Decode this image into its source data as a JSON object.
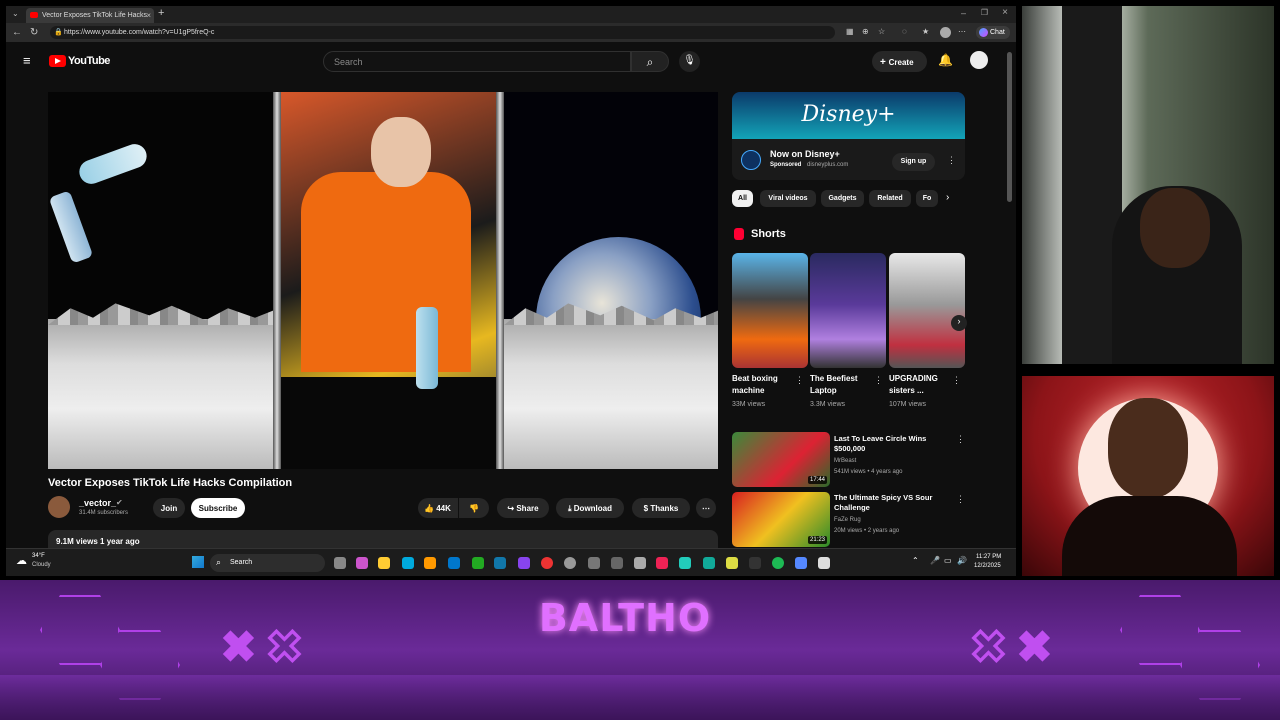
{
  "browser": {
    "tab_title": "Vector Exposes TikTok Life Hacks",
    "url": "https://www.youtube.com/watch?v=U1gP5freQ-c",
    "chat_label": "Chat"
  },
  "youtube": {
    "logo_text": "YouTube",
    "search_placeholder": "Search",
    "create_label": "Create"
  },
  "video": {
    "title": "Vector Exposes TikTok Life Hacks Compilation",
    "channel": "_vector_",
    "subscribers": "31.4M subscribers",
    "join_label": "Join",
    "subscribe_label": "Subscribe",
    "likes": "44K",
    "share_label": "Share",
    "download_label": "Download",
    "thanks_label": "Thanks",
    "views_date": "9.1M views  1 year ago"
  },
  "ad": {
    "brand_logo": "Disney+",
    "title": "Now on Disney+",
    "sponsored": "Sponsored",
    "domain": "disneyplus.com",
    "cta": "Sign up"
  },
  "chips": [
    "All",
    "Viral videos",
    "Gadgets",
    "Related",
    "Fo"
  ],
  "shorts": {
    "heading": "Shorts",
    "items": [
      {
        "title": "Beat boxing machine",
        "views": "33M views"
      },
      {
        "title": "The Beefiest Laptop",
        "views": "3.3M views"
      },
      {
        "title": "UPGRADING sisters ...",
        "views": "107M views"
      }
    ]
  },
  "related": [
    {
      "title": "Last To Leave Circle Wins $500,000",
      "channel": "MrBeast",
      "meta": "541M views • 4 years ago",
      "duration": "17:44"
    },
    {
      "title": "The Ultimate Spicy VS Sour Challenge",
      "channel": "FaZe Rug",
      "meta": "20M views • 2 years ago",
      "duration": "21:23"
    }
  ],
  "taskbar": {
    "temp": "34°F",
    "weather": "Cloudy",
    "search": "Search",
    "time": "11:27 PM",
    "date": "12/2/2025"
  },
  "banner": {
    "name": "BALTHO"
  },
  "colors": {
    "yt_red": "#ff0000",
    "banner_purple": "#6a2a98",
    "banner_text": "#e070ff"
  }
}
